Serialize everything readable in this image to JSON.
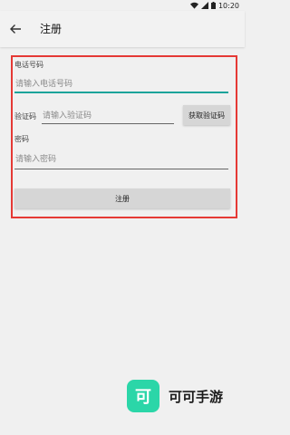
{
  "status_bar": {
    "time": "10:20"
  },
  "toolbar": {
    "title": "注册"
  },
  "form": {
    "phone": {
      "label": "电话号码",
      "placeholder": "请输入电话号码",
      "value": ""
    },
    "code": {
      "label": "验证码",
      "placeholder": "请输入验证码",
      "value": "",
      "button_label": "获取验证码"
    },
    "password": {
      "label": "密码",
      "placeholder": "请输入密码",
      "value": ""
    },
    "submit_label": "注册"
  },
  "brand": {
    "logo_char": "可",
    "name": "可可手游"
  },
  "colors": {
    "accent": "#1aa39a",
    "highlight_border": "#e53935",
    "brand": "#2bd6a8"
  }
}
